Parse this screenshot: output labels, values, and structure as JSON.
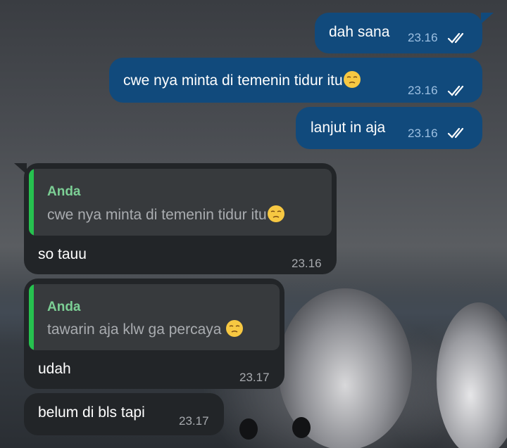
{
  "messages": [
    {
      "id": "m1",
      "direction": "outgoing",
      "text": "dah sana",
      "time": "23.16",
      "status": "read"
    },
    {
      "id": "m2",
      "direction": "outgoing",
      "text": "cwe nya minta di temenin tidur itu",
      "emoji": "unamused-face",
      "time": "23.16",
      "status": "read"
    },
    {
      "id": "m3",
      "direction": "outgoing",
      "text": "lanjut in aja",
      "time": "23.16",
      "status": "read"
    },
    {
      "id": "m4",
      "direction": "incoming",
      "quote": {
        "author": "Anda",
        "text": "cwe nya minta di temenin tidur itu",
        "emoji": "unamused-face"
      },
      "text": "so tauu",
      "time": "23.16"
    },
    {
      "id": "m5",
      "direction": "incoming",
      "quote": {
        "author": "Anda",
        "text": "tawarin aja klw ga percaya ",
        "emoji": "unamused-face"
      },
      "text": "udah",
      "time": "23.17"
    },
    {
      "id": "m6",
      "direction": "incoming",
      "text": "belum di bls tapi",
      "time": "23.17"
    }
  ],
  "colors": {
    "outgoing_bubble": "#114a7c",
    "incoming_bubble": "#222528",
    "quote_bar": "#26c14f",
    "quote_author": "#7ccf95",
    "read_ticks": "#ffffff"
  },
  "icons": {
    "status": "double-check-icon",
    "emoji": "unamused-face-emoji"
  }
}
